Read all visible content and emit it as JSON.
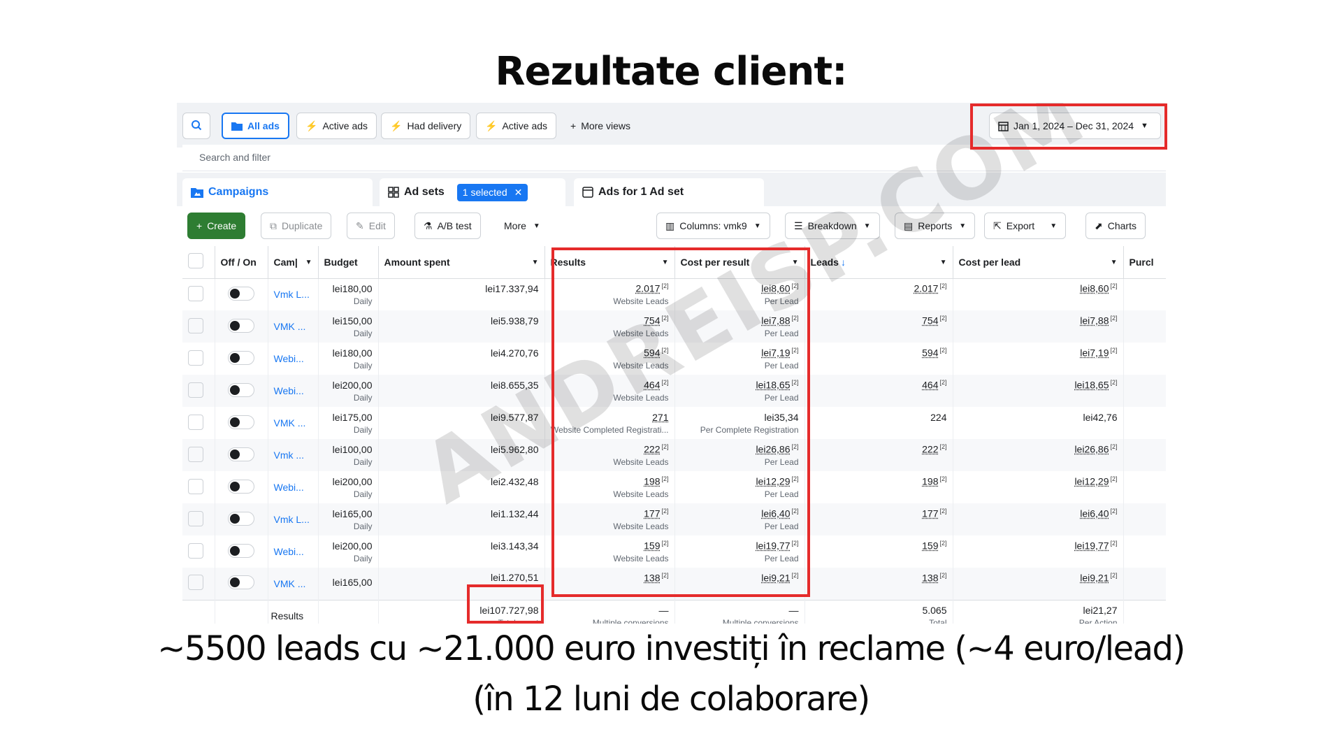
{
  "headline": "Rezultate client:",
  "caption": {
    "line1": "~5500 leads cu ~21.000 euro investiți în reclame (~4 euro/lead)",
    "line2": "(în 12 luni de colaborare)"
  },
  "watermark": "ANDREISP.COM",
  "views": {
    "all_ads": "All ads",
    "active_ads_1": "Active ads",
    "had_delivery": "Had delivery",
    "active_ads_2": "Active ads",
    "more_views": "More views"
  },
  "date_range": "Jan 1, 2024 – Dec 31, 2024",
  "search_placeholder": "Search and filter",
  "tabs": {
    "campaigns": "Campaigns",
    "ad_sets": "Ad sets",
    "selected": "1 selected",
    "ads": "Ads for 1 Ad set"
  },
  "toolbar": {
    "create": "Create",
    "duplicate": "Duplicate",
    "edit": "Edit",
    "ab_test": "A/B test",
    "more": "More",
    "columns": "Columns: vmk9",
    "breakdown": "Breakdown",
    "reports": "Reports",
    "export": "Export",
    "charts": "Charts"
  },
  "columns": {
    "off_on": "Off / On",
    "campaign": "Cam|",
    "budget": "Budget",
    "amount_spent": "Amount spent",
    "results": "Results",
    "cost_per_result": "Cost per result",
    "leads": "Leads",
    "cost_per_lead": "Cost per lead",
    "purchases": "Purcl"
  },
  "rows": [
    {
      "name": "Vmk L...",
      "budget": "lei180,00",
      "period": "Daily",
      "spent": "lei17.337,94",
      "results": "2.017",
      "results_type": "Website Leads",
      "cpr": "lei8,60",
      "cpr_type": "Per Lead",
      "leads": "2.017",
      "cpl": "lei8,60"
    },
    {
      "name": "VMK ...",
      "budget": "lei150,00",
      "period": "Daily",
      "spent": "lei5.938,79",
      "results": "754",
      "results_type": "Website Leads",
      "cpr": "lei7,88",
      "cpr_type": "Per Lead",
      "leads": "754",
      "cpl": "lei7,88"
    },
    {
      "name": "Webi...",
      "budget": "lei180,00",
      "period": "Daily",
      "spent": "lei4.270,76",
      "results": "594",
      "results_type": "Website Leads",
      "cpr": "lei7,19",
      "cpr_type": "Per Lead",
      "leads": "594",
      "cpl": "lei7,19"
    },
    {
      "name": "Webi...",
      "budget": "lei200,00",
      "period": "Daily",
      "spent": "lei8.655,35",
      "results": "464",
      "results_type": "Website Leads",
      "cpr": "lei18,65",
      "cpr_type": "Per Lead",
      "leads": "464",
      "cpl": "lei18,65"
    },
    {
      "name": "VMK ...",
      "budget": "lei175,00",
      "period": "Daily",
      "spent": "lei9.577,87",
      "results": "271",
      "results_type": "Website Completed Registrati...",
      "cpr": "lei35,34",
      "cpr_type": "Per Complete Registration",
      "leads": "224",
      "cpl": "lei42,76"
    },
    {
      "name": "Vmk ...",
      "budget": "lei100,00",
      "period": "Daily",
      "spent": "lei5.962,80",
      "results": "222",
      "results_type": "Website Leads",
      "cpr": "lei26,86",
      "cpr_type": "Per Lead",
      "leads": "222",
      "cpl": "lei26,86"
    },
    {
      "name": "Webi...",
      "budget": "lei200,00",
      "period": "Daily",
      "spent": "lei2.432,48",
      "results": "198",
      "results_type": "Website Leads",
      "cpr": "lei12,29",
      "cpr_type": "Per Lead",
      "leads": "198",
      "cpl": "lei12,29"
    },
    {
      "name": "Vmk L...",
      "budget": "lei165,00",
      "period": "Daily",
      "spent": "lei1.132,44",
      "results": "177",
      "results_type": "Website Leads",
      "cpr": "lei6,40",
      "cpr_type": "Per Lead",
      "leads": "177",
      "cpl": "lei6,40"
    },
    {
      "name": "Webi...",
      "budget": "lei200,00",
      "period": "Daily",
      "spent": "lei3.143,34",
      "results": "159",
      "results_type": "Website Leads",
      "cpr": "lei19,77",
      "cpr_type": "Per Lead",
      "leads": "159",
      "cpl": "lei19,77"
    },
    {
      "name": "VMK ...",
      "budget": "lei165,00",
      "period": "",
      "spent": "lei1.270,51",
      "results": "138",
      "results_type": "",
      "cpr": "lei9,21",
      "cpr_type": "",
      "leads": "138",
      "cpl": "lei9,21"
    }
  ],
  "totals": {
    "label": "Results",
    "spent": "lei107.727,98",
    "spent_note": "Total spent",
    "results_dash": "—",
    "results_note": "Multiple conversions",
    "cpr_dash": "—",
    "cpr_note": "Multiple conversions",
    "leads": "5.065",
    "leads_note": "Total",
    "cpl": "lei21,27",
    "cpl_note": "Per Action"
  },
  "footnote_marker": "[2]",
  "accent_colors": {
    "blue": "#1877f2",
    "green": "#2e7d32",
    "highlight": "#e52b2b"
  }
}
